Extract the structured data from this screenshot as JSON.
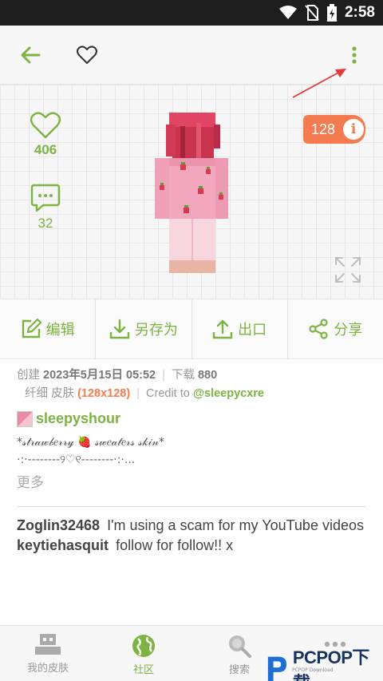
{
  "status_bar": {
    "time": "2:58"
  },
  "stats": {
    "likes": "406",
    "comments": "32"
  },
  "resolution_badge": {
    "label": "128",
    "info_symbol": "i"
  },
  "actions": [
    {
      "label": "编辑",
      "icon": "edit-icon"
    },
    {
      "label": "另存为",
      "icon": "download-icon"
    },
    {
      "label": "出口",
      "icon": "upload-icon"
    },
    {
      "label": "分享",
      "icon": "share-icon"
    }
  ],
  "meta": {
    "created_label": "创建",
    "created_value": "2023年5月15日 05:52",
    "downloads_label": "下载",
    "downloads_value": "880",
    "skin_type": "纤细 皮肤",
    "resolution": "(128x128)",
    "credit_label": "Credit to",
    "credit_user": "@sleepycxre"
  },
  "author": {
    "name": "sleepyshour"
  },
  "description": {
    "line1": "*𝓈𝓉𝓇𝒶𝓌𝒷𝑒𝓇𝓇𝓎 🍓 𝓈𝓌𝑒𝒶𝓉𝑒𝓇𝓈 𝓈𝓀𝒾𝓃*",
    "line2": "·:·--------୨♡୧--------·:·...",
    "more_label": "更多"
  },
  "comments": [
    {
      "user": "Zoglin32468",
      "text": "I'm using a scam for my YouTube videos"
    },
    {
      "user": "keytiehasquit",
      "text": "follow for follow!! x"
    }
  ],
  "tabs": [
    {
      "label": "我的皮肤",
      "icon": "my-skins-icon",
      "active": false
    },
    {
      "label": "社区",
      "icon": "globe-icon",
      "active": true
    },
    {
      "label": "搜索",
      "icon": "search-icon",
      "active": false
    },
    {
      "label": "",
      "icon": "more-dots-icon",
      "active": false
    }
  ],
  "watermark": {
    "brand": "PCPOP下载",
    "sub": "PCPOP Download"
  },
  "colors": {
    "accent": "#7cb342",
    "badge": "#f47b50",
    "annotation_arrow": "#e53935"
  }
}
